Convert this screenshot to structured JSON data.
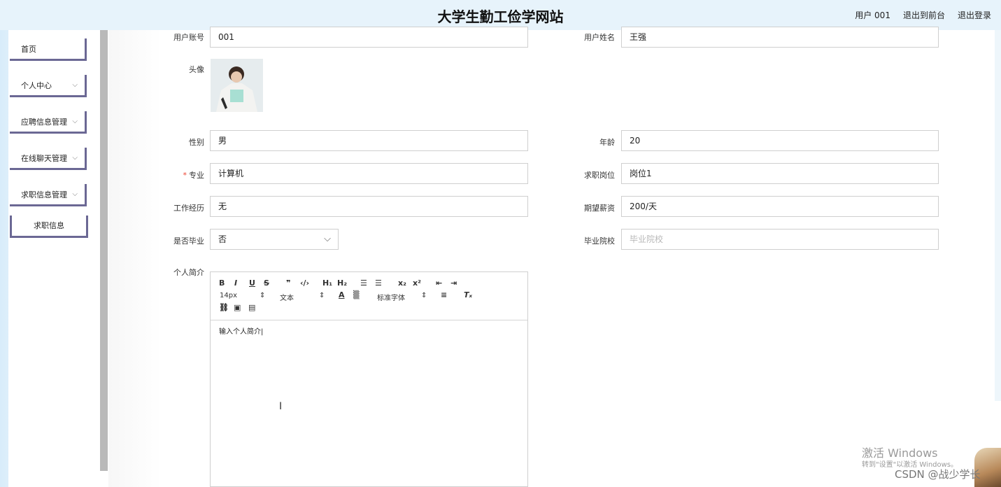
{
  "header": {
    "title": "大学生勤工俭学网站",
    "user": "用户 001",
    "front": "退出到前台",
    "logout": "退出登录"
  },
  "sidebar": {
    "items": [
      {
        "label": "首页"
      },
      {
        "label": "个人中心"
      },
      {
        "label": "应聘信息管理"
      },
      {
        "label": "在线聊天管理"
      },
      {
        "label": "求职信息管理"
      }
    ],
    "sub_item": "求职信息"
  },
  "form": {
    "account_label": "用户账号",
    "account_value": "001",
    "name_label": "用户姓名",
    "name_value": "王强",
    "avatar_label": "头像",
    "gender_label": "性别",
    "gender_value": "男",
    "age_label": "年龄",
    "age_value": "20",
    "major_label": "专业",
    "major_value": "计算机",
    "position_label": "求职岗位",
    "position_value": "岗位1",
    "experience_label": "工作经历",
    "experience_value": "无",
    "salary_label": "期望薪资",
    "salary_value": "200/天",
    "graduated_label": "是否毕业",
    "graduated_value": "否",
    "school_label": "毕业院校",
    "school_placeholder": "毕业院校",
    "intro_label": "个人简介"
  },
  "editor": {
    "font_size": "14px",
    "text_type": "文本",
    "font_family": "标准字体",
    "content": "输入个人简介"
  },
  "watermark": {
    "line1": "激活 Windows",
    "line2": "转到\"设置\"以激活 Windows。",
    "csdn": "CSDN @战少学长"
  }
}
